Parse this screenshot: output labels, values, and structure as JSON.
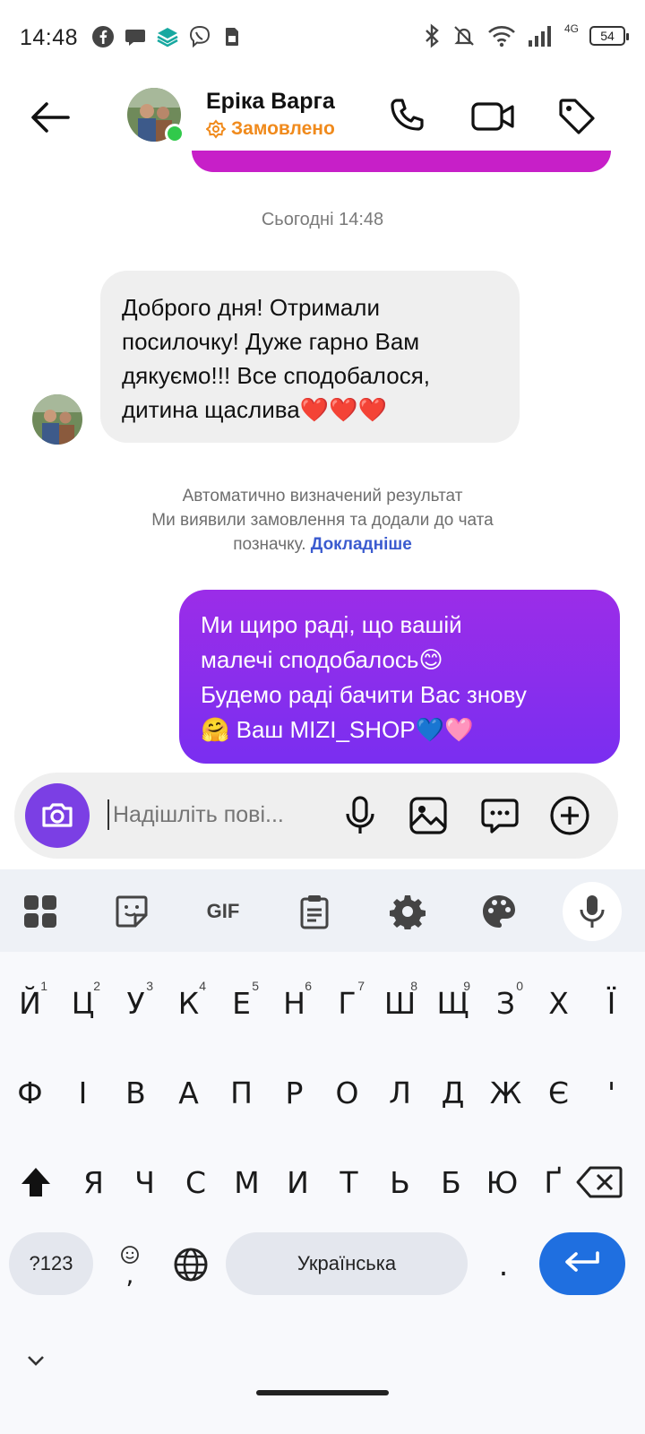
{
  "status_bar": {
    "time": "14:48",
    "network": "4G",
    "battery": "54"
  },
  "header": {
    "contact_name": "Еріка Варга",
    "contact_status": "Замовлено"
  },
  "messages": {
    "date_separator": "Сьогодні 14:48",
    "incoming": {
      "lines": [
        "Доброго дня! Отримали",
        "посилочку! Дуже гарно Вам",
        "дякуємо!!! Все сподобалося,",
        "дитина щаслива❤️❤️❤️"
      ]
    },
    "auto_note": {
      "line1": "Автоматично визначений результат",
      "line2": "Ми виявили замовлення та додали до чата",
      "line3_text": "позначку.",
      "link": "Докладніше"
    },
    "outgoing": {
      "lines": [
        "Ми щиро раді, що вашій",
        "малечі сподобалось😊",
        "Будемо раді бачити Вас знову",
        "🤗 Ваш MIZI_SHOP💙🩷"
      ]
    }
  },
  "composer": {
    "placeholder": "Надішліть пові..."
  },
  "keyboard": {
    "toolbar_gif": "GIF",
    "row1": [
      {
        "k": "Й",
        "n": "1"
      },
      {
        "k": "Ц",
        "n": "2"
      },
      {
        "k": "У",
        "n": "3"
      },
      {
        "k": "К",
        "n": "4"
      },
      {
        "k": "Е",
        "n": "5"
      },
      {
        "k": "Н",
        "n": "6"
      },
      {
        "k": "Г",
        "n": "7"
      },
      {
        "k": "Ш",
        "n": "8"
      },
      {
        "k": "Щ",
        "n": "9"
      },
      {
        "k": "З",
        "n": "0"
      },
      {
        "k": "Х",
        "n": ""
      },
      {
        "k": "Ї",
        "n": ""
      }
    ],
    "row2": [
      "Ф",
      "І",
      "В",
      "А",
      "П",
      "Р",
      "О",
      "Л",
      "Д",
      "Ж",
      "Є",
      "'"
    ],
    "row3": [
      "Я",
      "Ч",
      "С",
      "М",
      "И",
      "Т",
      "Ь",
      "Б",
      "Ю",
      "Ґ"
    ],
    "symbols_key": "?123",
    "comma_key": ",",
    "space_label": "Українська",
    "period_key": "."
  }
}
